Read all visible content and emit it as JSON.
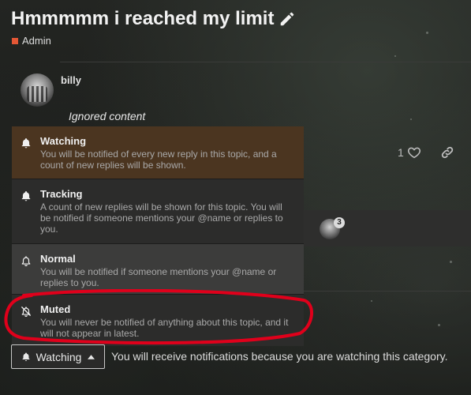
{
  "topic": {
    "title": "Hmmmmm i reached my limit",
    "category": "Admin",
    "category_color": "#e45735"
  },
  "post": {
    "username": "billy",
    "ignored_text": "Ignored content",
    "like_count": "1"
  },
  "participants": {
    "count": "3"
  },
  "notification_menu": {
    "options": [
      {
        "label": "Watching",
        "description": "You will be notified of every new reply in this topic, and a count of new replies will be shown."
      },
      {
        "label": "Tracking",
        "description": "A count of new replies will be shown for this topic. You will be notified if someone mentions your @name or replies to you."
      },
      {
        "label": "Normal",
        "description": "You will be notified if someone mentions your @name or replies to you."
      },
      {
        "label": "Muted",
        "description": "You will never be notified of anything about this topic, and it will not appear in latest."
      }
    ],
    "selected": "Watching"
  },
  "footer": {
    "button_label": "Watching",
    "reason_text": "You will receive notifications because you are watching this category."
  },
  "colors": {
    "watching_bg": "#4b3520",
    "highlight_circle": "#e0001b"
  }
}
